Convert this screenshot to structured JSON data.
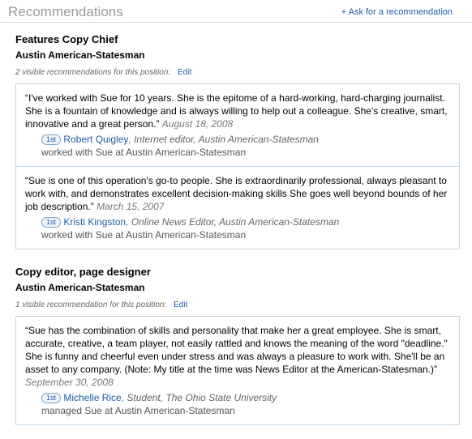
{
  "header": {
    "title": "Recommendations",
    "ask_link": "+ Ask for a recommendation"
  },
  "positions": [
    {
      "title": "Features Copy Chief",
      "company": "Austin American-Statesman",
      "count_text": "2 visible recommendations for this position:",
      "edit_label": "Edit",
      "recommendations": [
        {
          "quote": "“I've worked with Sue for 10 years. She is the epitome of a hard-working, hard-charging journalist. She is a fountain of knowledge and is always willing to help out a colleague. She's creative, smart, innovative and a great person.”",
          "date": "August 18, 2008",
          "badge": "1st",
          "name": "Robert Quigley",
          "role": ", Internet editor, Austin American-Statesman",
          "relation": "worked with Sue at Austin American-Statesman"
        },
        {
          "quote": "“Sue is one of this operation's go-to people. She is extraordinarily professional, always pleasant to work with, and demonstrates excellent decision-making skills She goes well beyond bounds of her job description.”",
          "date": "March 15, 2007",
          "badge": "1st",
          "name": "Kristi Kingston",
          "role": ", Online News Editor, Austin American-Statesman",
          "relation": "worked with Sue at Austin American-Statesman"
        }
      ]
    },
    {
      "title": "Copy editor, page designer",
      "company": "Austin American-Statesman",
      "count_text": "1 visible recommendation for this position:",
      "edit_label": "Edit",
      "recommendations": [
        {
          "quote": "“Sue has the combination of skills and personality that make her a great employee. She is smart, accurate, creative, a team player, not easily rattled and knows the meaning of the word \"deadline.\" She is funny and cheerful even under stress and was always a pleasure to work with. She'll be an asset to any company. (Note: My title at the time was News Editor at the American-Statesman.)”",
          "date": "September 30, 2008",
          "badge": "1st",
          "name": "Michelle Rice",
          "role": ", Student, The Ohio State University",
          "relation": "managed Sue at Austin American-Statesman"
        }
      ]
    }
  ],
  "colors": {
    "link": "#1f5fa6",
    "box_border": "#c5d6e5",
    "muted": "#999999"
  }
}
